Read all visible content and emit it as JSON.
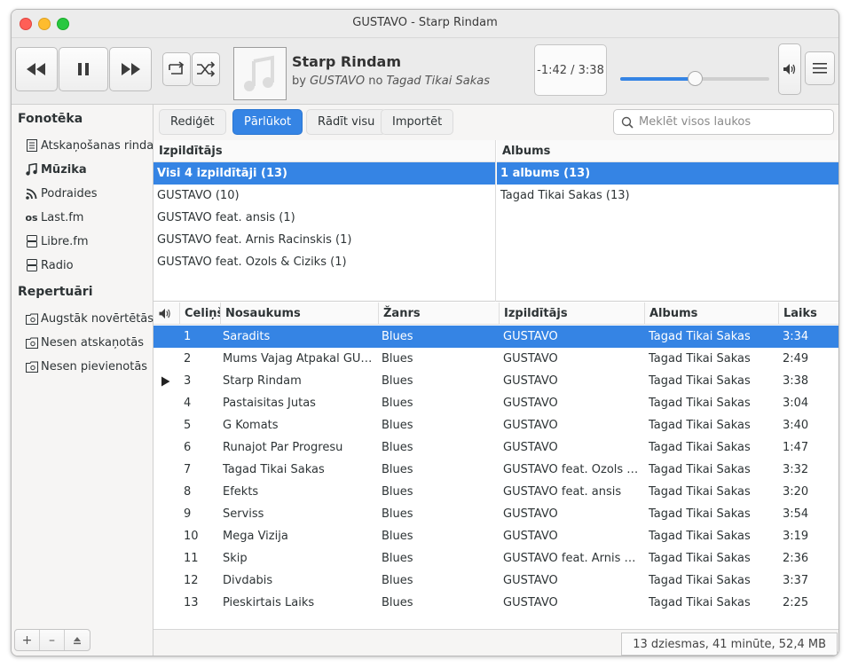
{
  "window": {
    "title": "GUSTAVO - Starp Rindam"
  },
  "now_playing": {
    "title": "Starp Rindam",
    "by_label": "by",
    "artist": "GUSTAVO",
    "from_label": "no",
    "album": "Tagad Tikai Sakas",
    "time": "-1:42 / 3:38",
    "progress_fraction": 0.5
  },
  "sidebar": {
    "library_heading": "Fonotēka",
    "library_items": [
      {
        "label": "Atskaņošanas rinda",
        "icon": "queue-icon"
      },
      {
        "label": "Mūzika",
        "icon": "music-note-icon"
      },
      {
        "label": "Podraides",
        "icon": "rss-icon"
      },
      {
        "label": "Last.fm",
        "icon": "lastfm-icon"
      },
      {
        "label": "Libre.fm",
        "icon": "server-icon"
      },
      {
        "label": "Radio",
        "icon": "radio-icon"
      }
    ],
    "playlists_heading": "Repertuāri",
    "playlist_items": [
      {
        "label": "Augstāk novērtētās",
        "icon": "smart-playlist-icon"
      },
      {
        "label": "Nesen atskaņotās",
        "icon": "smart-playlist-icon"
      },
      {
        "label": "Nesen pievienotās",
        "icon": "smart-playlist-icon"
      }
    ]
  },
  "tabs": [
    {
      "label": "Rediģēt"
    },
    {
      "label": "Pārlūkot",
      "active": true
    },
    {
      "label": "Rādīt visu"
    },
    {
      "label": "Importēt"
    }
  ],
  "search": {
    "placeholder": "Meklēt visos laukos"
  },
  "browser": {
    "artists": {
      "header": "Izpildītājs",
      "rows": [
        "Visi 4 izpildītāji (13)",
        "GUSTAVO (10)",
        "GUSTAVO feat. ansis (1)",
        "GUSTAVO feat. Arnis Racinskis (1)",
        "GUSTAVO feat. Ozols & Ciziks (1)"
      ]
    },
    "albums": {
      "header": "Albums",
      "rows": [
        "1 albums (13)",
        "Tagad Tikai Sakas (13)"
      ]
    }
  },
  "tracks": {
    "columns": {
      "track": "Celiņš",
      "title": "Nosaukums",
      "genre": "Žanrs",
      "artist": "Izpildītājs",
      "album": "Albums",
      "length": "Laiks"
    },
    "rows": [
      {
        "n": "1",
        "title": "Saradits",
        "genre": "Blues",
        "artist": "GUSTAVO",
        "album": "Tagad Tikai Sakas",
        "time": "3:34"
      },
      {
        "n": "2",
        "title": "Mums Vajag Atpakal GUSTAVO",
        "genre": "Blues",
        "artist": "GUSTAVO",
        "album": "Tagad Tikai Sakas",
        "time": "2:49"
      },
      {
        "n": "3",
        "title": "Starp Rindam",
        "genre": "Blues",
        "artist": "GUSTAVO",
        "album": "Tagad Tikai Sakas",
        "time": "3:38"
      },
      {
        "n": "4",
        "title": "Pastaisitas Jutas",
        "genre": "Blues",
        "artist": "GUSTAVO",
        "album": "Tagad Tikai Sakas",
        "time": "3:04"
      },
      {
        "n": "5",
        "title": "G Komats",
        "genre": "Blues",
        "artist": "GUSTAVO",
        "album": "Tagad Tikai Sakas",
        "time": "3:40"
      },
      {
        "n": "6",
        "title": "Runajot Par Progresu",
        "genre": "Blues",
        "artist": "GUSTAVO",
        "album": "Tagad Tikai Sakas",
        "time": "1:47"
      },
      {
        "n": "7",
        "title": "Tagad Tikai Sakas",
        "genre": "Blues",
        "artist": "GUSTAVO feat. Ozols & Ciziks",
        "album": "Tagad Tikai Sakas",
        "time": "3:32"
      },
      {
        "n": "8",
        "title": "Efekts",
        "genre": "Blues",
        "artist": "GUSTAVO feat. ansis",
        "album": "Tagad Tikai Sakas",
        "time": "3:20"
      },
      {
        "n": "9",
        "title": "Serviss",
        "genre": "Blues",
        "artist": "GUSTAVO",
        "album": "Tagad Tikai Sakas",
        "time": "3:54"
      },
      {
        "n": "10",
        "title": "Mega Vizija",
        "genre": "Blues",
        "artist": "GUSTAVO",
        "album": "Tagad Tikai Sakas",
        "time": "3:19"
      },
      {
        "n": "11",
        "title": "Skip",
        "genre": "Blues",
        "artist": "GUSTAVO feat. Arnis Racinskis",
        "album": "Tagad Tikai Sakas",
        "time": "2:36"
      },
      {
        "n": "12",
        "title": "Divdabis",
        "genre": "Blues",
        "artist": "GUSTAVO",
        "album": "Tagad Tikai Sakas",
        "time": "3:37"
      },
      {
        "n": "13",
        "title": "Pieskirtais Laiks",
        "genre": "Blues",
        "artist": "GUSTAVO",
        "album": "Tagad Tikai Sakas",
        "time": "2:25"
      }
    ],
    "selected_index": 0,
    "playing_index": 2
  },
  "status": {
    "summary": "13 dziesmas, 41 minūte, 52,4 MB"
  },
  "colors": {
    "accent": "#3584e4"
  }
}
